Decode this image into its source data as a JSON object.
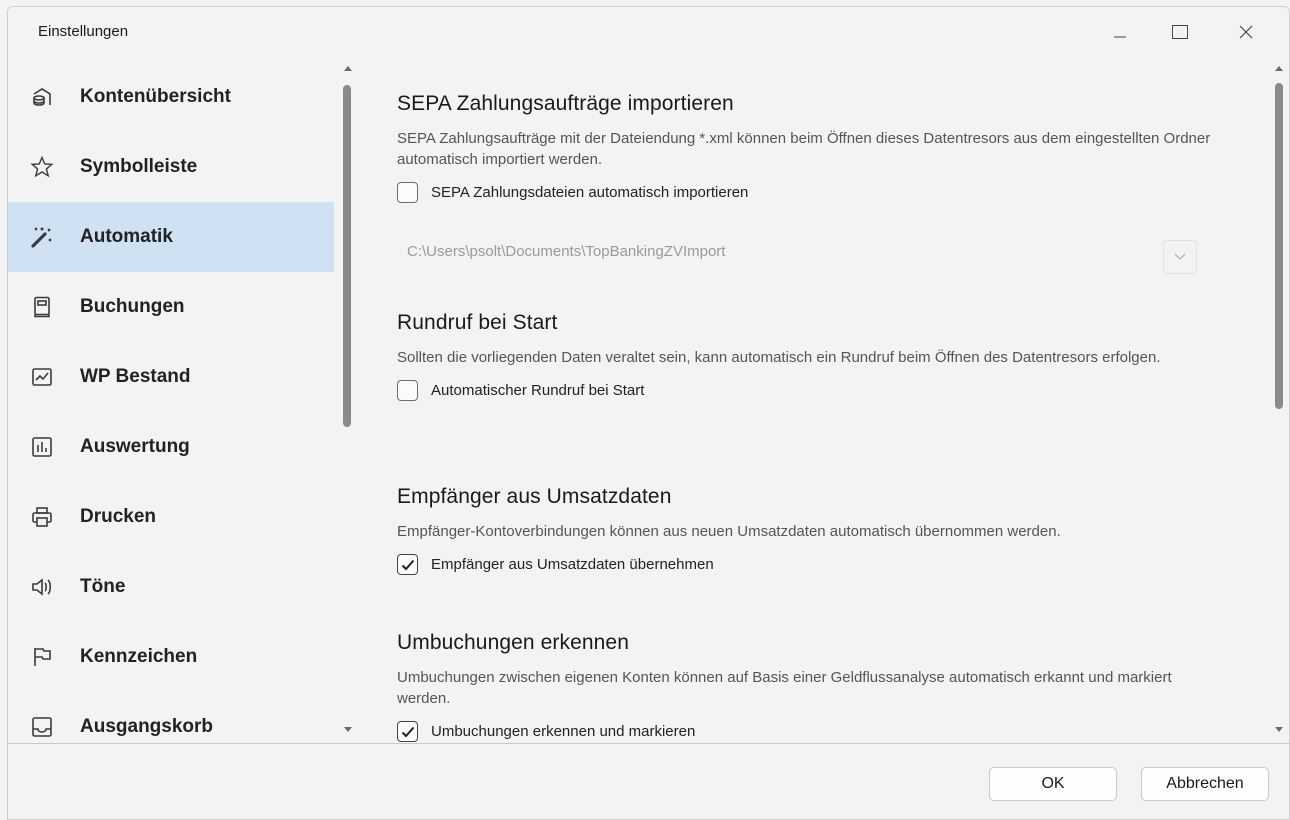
{
  "window": {
    "title": "Einstellungen"
  },
  "sidebar": {
    "items": [
      {
        "label": "Kontenübersicht",
        "icon": "coins-icon",
        "active": false
      },
      {
        "label": "Symbolleiste",
        "icon": "star-icon",
        "active": false
      },
      {
        "label": "Automatik",
        "icon": "magic-wand-icon",
        "active": true
      },
      {
        "label": "Buchungen",
        "icon": "ledger-icon",
        "active": false
      },
      {
        "label": "WP Bestand",
        "icon": "chart-line-icon",
        "active": false
      },
      {
        "label": "Auswertung",
        "icon": "bar-chart-icon",
        "active": false
      },
      {
        "label": "Drucken",
        "icon": "printer-icon",
        "active": false
      },
      {
        "label": "Töne",
        "icon": "speaker-icon",
        "active": false
      },
      {
        "label": "Kennzeichen",
        "icon": "flag-icon",
        "active": false
      },
      {
        "label": "Ausgangskorb",
        "icon": "outbox-icon",
        "active": false
      }
    ]
  },
  "sections": {
    "sepa": {
      "title": "SEPA Zahlungsaufträge importieren",
      "desc": "SEPA Zahlungsaufträge mit der Dateiendung *.xml können beim Öffnen dieses Datentresors aus dem eingestellten Ordner automatisch importiert werden.",
      "checkbox": "SEPA Zahlungsdateien automatisch importieren",
      "checked": false,
      "path": "C:\\Users\\psolt\\Documents\\TopBankingZVImport"
    },
    "rundruf": {
      "title": "Rundruf bei Start",
      "desc": "Sollten die vorliegenden Daten veraltet sein, kann automatisch ein Rundruf beim Öffnen des Datentresors erfolgen.",
      "checkbox": "Automatischer Rundruf bei Start",
      "checked": false
    },
    "empfaenger": {
      "title": "Empfänger aus Umsatzdaten",
      "desc": "Empfänger-Kontoverbindungen können aus neuen Umsatzdaten automatisch übernommen werden.",
      "checkbox": "Empfänger aus Umsatzdaten übernehmen",
      "checked": true
    },
    "umbuchungen": {
      "title": "Umbuchungen erkennen",
      "desc": "Umbuchungen zwischen eigenen Konten können auf Basis einer Geldflussanalyse automatisch erkannt und markiert werden.",
      "checkbox": "Umbuchungen erkennen und markieren",
      "checked": true
    }
  },
  "footer": {
    "ok_label": "OK",
    "cancel_label": "Abbrechen"
  }
}
